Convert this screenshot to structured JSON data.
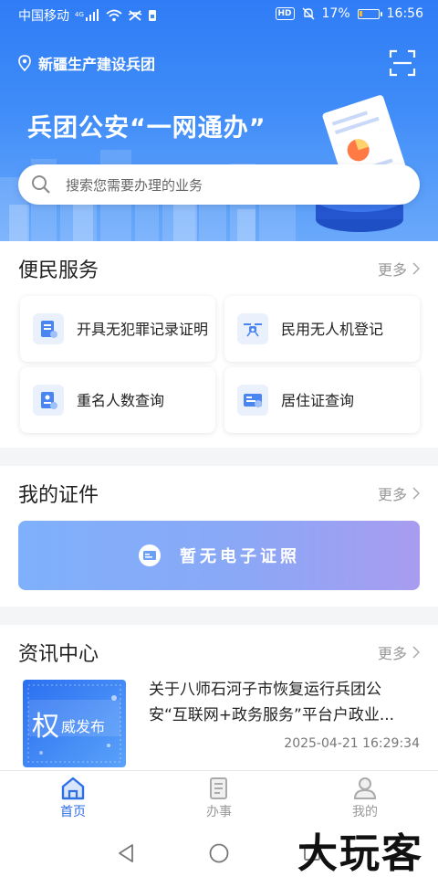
{
  "status_bar": {
    "carrier": "中国移动",
    "network": "4G",
    "hd_badge": "HD",
    "battery_percent": "17%",
    "battery_level": 0.17,
    "time": "16:56"
  },
  "header": {
    "location": "新疆生产建设兵团",
    "slogan": "兵团公安“一网通办”"
  },
  "search": {
    "placeholder": "搜索您需要办理的业务"
  },
  "convenience": {
    "title": "便民服务",
    "more": "更多",
    "items": [
      {
        "label": "开具无犯罪记录证明",
        "icon": "certificate-icon"
      },
      {
        "label": "民用无人机登记",
        "icon": "drone-icon"
      },
      {
        "label": "重名人数查询",
        "icon": "name-query-icon"
      },
      {
        "label": "居住证查询",
        "icon": "residence-card-icon"
      }
    ]
  },
  "certificates": {
    "title": "我的证件",
    "more": "更多",
    "empty_text": "暂无电子证照"
  },
  "news": {
    "title": "资讯中心",
    "more": "更多",
    "item": {
      "thumb_big": "权",
      "thumb_small": "威发布",
      "title_line1": "关于八师石河子市恢复运行兵团公",
      "title_line2": "安“互联网+政务服务”平台户政业...",
      "time": "2025-04-21 16:29:34"
    }
  },
  "tabs": [
    {
      "label": "首页",
      "icon": "home-icon",
      "active": true
    },
    {
      "label": "办事",
      "icon": "document-icon",
      "active": false
    },
    {
      "label": "我的",
      "icon": "user-icon",
      "active": false
    }
  ],
  "watermark": "大玩客",
  "colors": {
    "brand": "#2f7cf6",
    "tab_active": "#2f6fe6",
    "tab_inactive": "#999999"
  }
}
